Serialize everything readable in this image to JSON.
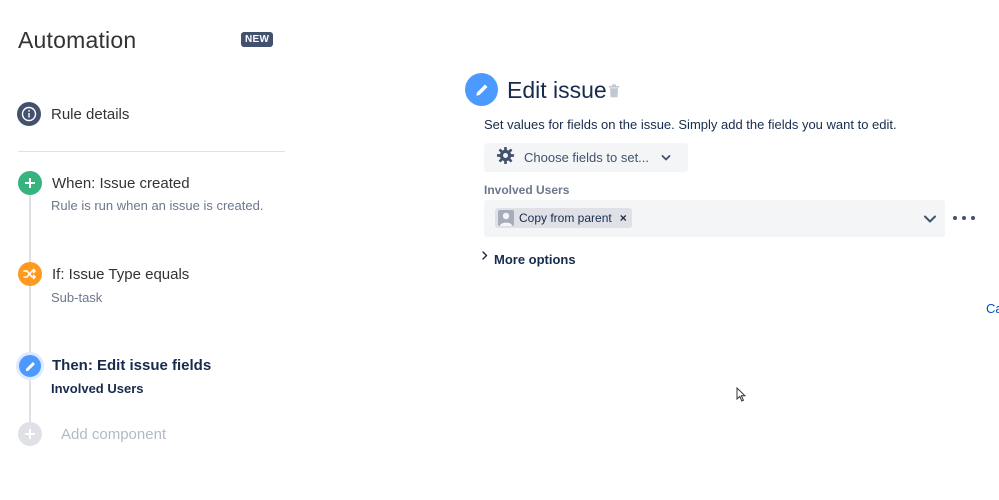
{
  "header": {
    "title": "Automation",
    "badge": "NEW"
  },
  "rule": {
    "details_label": "Rule details",
    "trigger": {
      "title": "When: Issue created",
      "description": "Rule is run when an issue is created."
    },
    "condition": {
      "title": "If: Issue Type equals",
      "description": "Sub-task"
    },
    "action": {
      "title": "Then: Edit issue fields",
      "description": "Involved Users"
    },
    "add_component_label": "Add component"
  },
  "editor": {
    "title": "Edit issue",
    "description": "Set values for fields on the issue. Simply add the fields you want to edit.",
    "choose_fields_label": "Choose fields to set...",
    "field": {
      "label": "Involved Users",
      "selected_value": "Copy from parent",
      "remove_glyph": "×"
    },
    "more_options_label": "More options",
    "cancel_label": "Ca"
  },
  "colors": {
    "trigger": "#36b37e",
    "condition": "#ff991f",
    "action": "#4c9aff",
    "rule_details": "#42526e",
    "link": "#0052cc"
  },
  "icons": {
    "rule_details": "info-icon",
    "trigger": "plus-icon",
    "condition": "shuffle-icon",
    "action": "pencil-icon",
    "add": "plus-icon",
    "trash": "trash-icon",
    "settings": "gear-icon",
    "chevron": "chevron-down-icon",
    "more": "more-icon"
  }
}
